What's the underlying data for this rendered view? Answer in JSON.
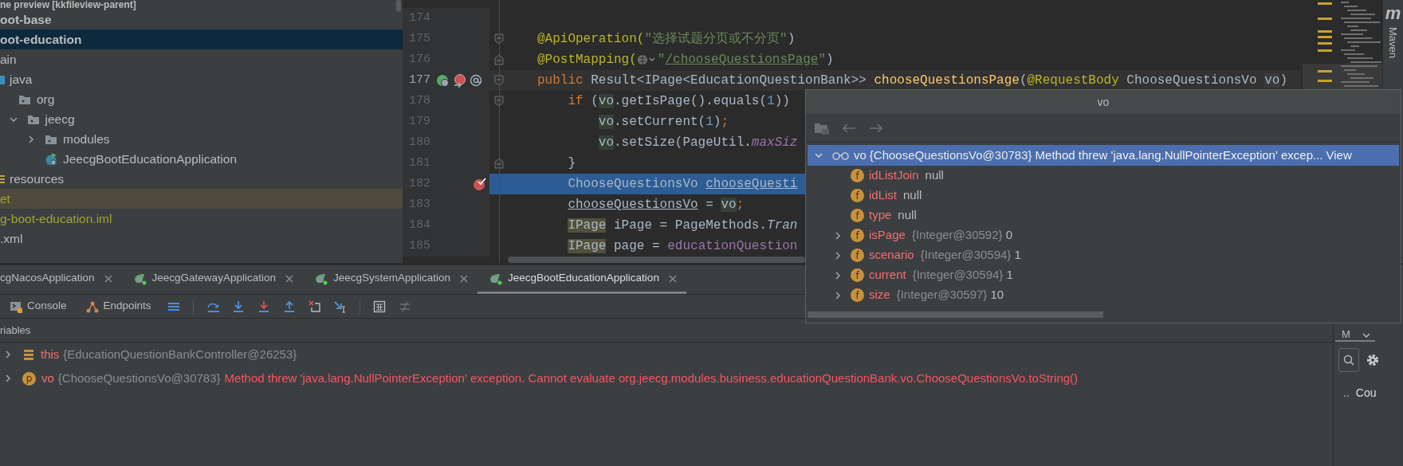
{
  "project_tree": [
    {
      "text": "ne preview [kkfileview-parent]",
      "kind": "module_cut",
      "selected": false
    },
    {
      "text": "oot-base",
      "kind": "module",
      "selected": false
    },
    {
      "text": "oot-education",
      "kind": "module",
      "selected": true,
      "children": [
        {
          "text": "ain",
          "kind": "folder",
          "selected": false,
          "children": [
            {
              "text": "java",
              "kind": "source_root",
              "selected": false,
              "children": [
                {
                  "text": "org",
                  "kind": "package",
                  "selected": false,
                  "children": [
                    {
                      "text": "jeecg",
                      "kind": "package",
                      "selected": false,
                      "expanded": true,
                      "children": [
                        {
                          "text": "modules",
                          "kind": "package",
                          "selected": false,
                          "expanded": false
                        },
                        {
                          "text": "JeecgBootEducationApplication",
                          "kind": "app_class",
                          "selected": false
                        }
                      ]
                    }
                  ]
                }
              ]
            },
            {
              "text": "resources",
              "kind": "resources_root",
              "selected": false
            }
          ]
        },
        {
          "text": "et",
          "kind": "excluded",
          "selected": false
        },
        {
          "text": "g-boot-education.iml",
          "kind": "ignored_file",
          "selected": false
        },
        {
          "text": ".xml",
          "kind": "file",
          "selected": false
        }
      ]
    }
  ],
  "editor": {
    "lines": [
      {
        "number": "174",
        "caret": false,
        "breakpoint": false,
        "execution": false
      },
      {
        "number": "175",
        "caret": false,
        "breakpoint": false,
        "execution": false,
        "fold": {
          "kind": "start"
        },
        "tokens": [
          {
            "text": "@ApiOperation(",
            "kind": "annotation"
          },
          {
            "text": "\"选择试题分页或不分页\"",
            "kind": "string"
          },
          {
            "text": ")",
            "kind": "plain"
          }
        ]
      },
      {
        "number": "176",
        "caret": false,
        "breakpoint": false,
        "execution": false,
        "fold": {
          "kind": "end"
        },
        "tokens": [
          {
            "text": "@PostMapping(",
            "kind": "annotation"
          },
          {
            "kind": "endpoint_inlay"
          },
          {
            "text": "\"",
            "kind": "string"
          },
          {
            "text": "/chooseQuestionsPage",
            "kind": "url"
          },
          {
            "text": "\"",
            "kind": "string"
          },
          {
            "text": ")",
            "kind": "plain"
          }
        ]
      },
      {
        "number": "177",
        "caret": true,
        "breakpoint": false,
        "execution": false,
        "fold": {
          "kind": "start"
        },
        "gutter_icons": [
          {
            "kind": "spring_endpoint"
          },
          {
            "kind": "mapping"
          },
          {
            "kind": "annotation"
          }
        ],
        "tokens": [
          {
            "text": "public",
            "kind": "keyword"
          },
          {
            "text": " Result<IPage<EducationQuestionBank>> ",
            "kind": "plain"
          },
          {
            "text": "chooseQuestionsPage",
            "kind": "method"
          },
          {
            "text": "(",
            "kind": "plain"
          },
          {
            "text": "@RequestBody",
            "kind": "annotation"
          },
          {
            "text": " ChooseQuestionsVo ",
            "kind": "plain"
          },
          {
            "text": "vo",
            "kind": "param_usage"
          },
          {
            "text": ")",
            "kind": "plain"
          }
        ],
        "children": [
          {
            "number": "178",
            "caret": false,
            "breakpoint": false,
            "execution": false,
            "fold": {
              "kind": "start"
            },
            "tokens": [
              {
                "text": "if",
                "kind": "keyword"
              },
              {
                "text": " (",
                "kind": "plain"
              },
              {
                "text": "vo",
                "kind": "read_usage"
              },
              {
                "text": ".getIsPage().equals(",
                "kind": "plain"
              },
              {
                "text": "1",
                "kind": "number"
              },
              {
                "text": "))",
                "kind": "plain"
              }
            ],
            "children": [
              {
                "number": "179",
                "caret": false,
                "breakpoint": false,
                "execution": false,
                "tokens": [
                  {
                    "text": "vo",
                    "kind": "read_usage"
                  },
                  {
                    "text": ".setCurrent(",
                    "kind": "plain"
                  },
                  {
                    "text": "1",
                    "kind": "number"
                  },
                  {
                    "text": ")",
                    "kind": "plain"
                  },
                  {
                    "text": ";",
                    "kind": "keyword"
                  }
                ]
              },
              {
                "number": "180",
                "caret": false,
                "breakpoint": false,
                "execution": false,
                "tokens": [
                  {
                    "text": "vo",
                    "kind": "read_usage"
                  },
                  {
                    "text": ".setSize(PageUtil.",
                    "kind": "plain"
                  },
                  {
                    "text": "maxSiz",
                    "kind": "static_field"
                  }
                ]
              }
            ]
          },
          {
            "number": "181",
            "caret": false,
            "breakpoint": false,
            "execution": false,
            "fold": {
              "kind": "end"
            },
            "tokens": [
              {
                "text": "}",
                "kind": "plain"
              }
            ]
          },
          {
            "number": "182",
            "caret": false,
            "breakpoint": true,
            "execution": true,
            "tokens": [
              {
                "text": "ChooseQuestionsVo ",
                "kind": "plain"
              },
              {
                "text": "chooseQuesti",
                "kind": "reassigned"
              }
            ]
          },
          {
            "number": "183",
            "caret": false,
            "breakpoint": false,
            "execution": false,
            "tokens": [
              {
                "text": "chooseQuestionsVo",
                "kind": "reassigned"
              },
              {
                "text": " = ",
                "kind": "plain"
              },
              {
                "text": "vo",
                "kind": "read_usage"
              },
              {
                "text": ";",
                "kind": "keyword"
              }
            ]
          },
          {
            "number": "184",
            "caret": false,
            "breakpoint": false,
            "execution": false,
            "tokens": [
              {
                "text": "IPage",
                "kind": "type_usage"
              },
              {
                "text": " iPage = PageMethods.",
                "kind": "plain"
              },
              {
                "text": "Tran",
                "kind": "static_call"
              }
            ]
          },
          {
            "number": "185",
            "caret": false,
            "breakpoint": false,
            "execution": false,
            "tokens": [
              {
                "text": "IPage",
                "kind": "type_usage"
              },
              {
                "text": " page = ",
                "kind": "plain"
              },
              {
                "text": "educationQuestion",
                "kind": "field"
              }
            ]
          }
        ]
      }
    ]
  },
  "maven_strip": {
    "logo": "m",
    "label": "Maven"
  },
  "value_popup": {
    "title": "vo",
    "root": {
      "kind": "watch",
      "name": "vo",
      "value": "{ChooseQuestionsVo@30783}",
      "message": "Method threw 'java.lang.NullPointerException' excep...",
      "link": "View",
      "expanded": true,
      "selected": true
    },
    "fields": [
      {
        "badge": "f",
        "name": "idListJoin",
        "value": "null",
        "selected": false
      },
      {
        "badge": "f",
        "name": "idList",
        "value": "null",
        "selected": false
      },
      {
        "badge": "f",
        "name": "type",
        "value": "null",
        "selected": false
      },
      {
        "badge": "f",
        "name": "isPage",
        "ref": "{Integer@30592}",
        "value": "0",
        "expanded": false,
        "selected": false
      },
      {
        "badge": "f",
        "name": "scenario",
        "ref": "{Integer@30594}",
        "value": "1",
        "expanded": false,
        "selected": false
      },
      {
        "badge": "f",
        "name": "current",
        "ref": "{Integer@30594}",
        "value": "1",
        "expanded": false,
        "selected": false
      },
      {
        "badge": "f",
        "name": "size",
        "ref": "{Integer@30597}",
        "value": "10",
        "expanded": false,
        "selected": false
      }
    ]
  },
  "run_tabs": [
    {
      "label": "cgNacosApplication",
      "icon_visible": false,
      "selected": false
    },
    {
      "label": "JeecgGatewayApplication",
      "icon_visible": true,
      "selected": false
    },
    {
      "label": "JeecgSystemApplication",
      "icon_visible": true,
      "selected": false
    },
    {
      "label": "JeecgBootEducationApplication",
      "icon_visible": true,
      "selected": true
    }
  ],
  "debug_toolbar": [
    [
      {
        "kind": "console",
        "label": "Console",
        "disabled": false
      },
      {
        "kind": "endpoints",
        "label": "Endpoints",
        "disabled": false
      },
      {
        "kind": "frames",
        "disabled": false
      }
    ],
    [
      {
        "kind": "step_over",
        "disabled": false
      },
      {
        "kind": "step_into",
        "disabled": false
      },
      {
        "kind": "force_step_into",
        "disabled": false
      },
      {
        "kind": "step_out",
        "disabled": false
      },
      {
        "kind": "drop_frame",
        "disabled": false
      },
      {
        "kind": "run_to_cursor",
        "disabled": false
      }
    ],
    [
      {
        "kind": "evaluate",
        "disabled": false
      },
      {
        "kind": "trace",
        "disabled": true
      }
    ]
  ],
  "variables": {
    "header": "riables",
    "items": [
      {
        "kind": "object",
        "name": "this",
        "value": "{EducationQuestionBankController@26253}",
        "expanded": false
      },
      {
        "kind": "param",
        "badge": "p",
        "name": "vo",
        "value": "{ChooseQuestionsVo@30783}",
        "message": "Method threw 'java.lang.NullPointerException' exception. Cannot evaluate org.jeecg.modules.business.educationQuestionBank.vo.ChooseQuestionsVo.toString()",
        "expanded": false
      }
    ]
  },
  "side_panel": {
    "tab": "M",
    "more": "..",
    "label": "Cou"
  }
}
